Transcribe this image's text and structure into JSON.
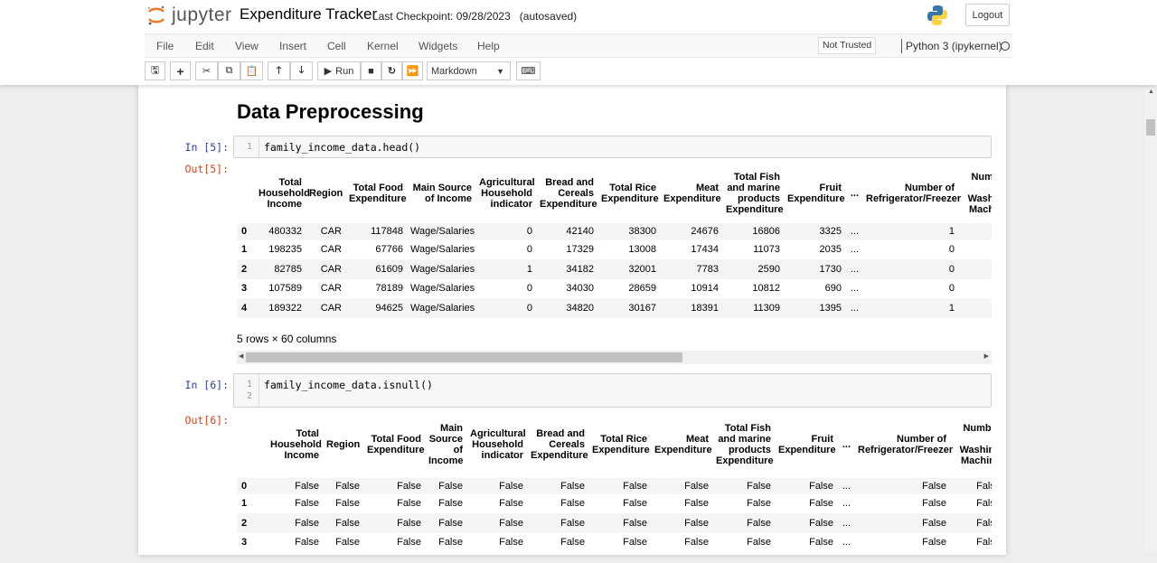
{
  "header": {
    "logo_text": "jupyter",
    "notebook_title": "Expenditure Tracker",
    "checkpoint": "Last Checkpoint: 09/28/2023",
    "autosave": "(autosaved)",
    "logout_label": "Logout"
  },
  "menubar": {
    "items": [
      "File",
      "Edit",
      "View",
      "Insert",
      "Cell",
      "Kernel",
      "Widgets",
      "Help"
    ],
    "trust_label": "Not Trusted",
    "kernel_name": "Python 3 (ipykernel)"
  },
  "toolbar": {
    "run_label": "Run",
    "cell_type": "Markdown"
  },
  "cells": [
    {
      "type": "markdown",
      "text": "Data Preprocessing"
    },
    {
      "in_prompt": "In [5]:",
      "out_prompt": "Out[5]:",
      "code": [
        "family_income_data.head()"
      ],
      "line_numbers": [
        "1"
      ],
      "columns": [
        "",
        "Total Household Income",
        "Region",
        "Total Food Expenditure",
        "Main Source of Income",
        "Agricultural Household indicator",
        "Bread and Cereals Expenditure",
        "Total Rice Expenditure",
        "Meat Expenditure",
        "Total Fish and marine products Expenditure",
        "Fruit Expenditure",
        "...",
        "Number of Refrigerator/Freezer",
        "Number of Washing Machine"
      ],
      "rows": [
        [
          "0",
          "480332",
          "CAR",
          "117848",
          "Wage/Salaries",
          "0",
          "42140",
          "38300",
          "24676",
          "16806",
          "3325",
          "...",
          "1",
          ""
        ],
        [
          "1",
          "198235",
          "CAR",
          "67766",
          "Wage/Salaries",
          "0",
          "17329",
          "13008",
          "17434",
          "11073",
          "2035",
          "...",
          "0",
          ""
        ],
        [
          "2",
          "82785",
          "CAR",
          "61609",
          "Wage/Salaries",
          "1",
          "34182",
          "32001",
          "7783",
          "2590",
          "1730",
          "...",
          "0",
          ""
        ],
        [
          "3",
          "107589",
          "CAR",
          "78189",
          "Wage/Salaries",
          "0",
          "34030",
          "28659",
          "10914",
          "10812",
          "690",
          "...",
          "0",
          ""
        ],
        [
          "4",
          "189322",
          "CAR",
          "94625",
          "Wage/Salaries",
          "0",
          "34820",
          "30167",
          "18391",
          "11309",
          "1395",
          "...",
          "1",
          ""
        ]
      ],
      "shape": "5 rows × 60 columns"
    },
    {
      "in_prompt": "In [6]:",
      "out_prompt": "Out[6]:",
      "code": [
        "family_income_data.isnull()",
        ""
      ],
      "line_numbers": [
        "1",
        "2"
      ],
      "columns": [
        "",
        "Total Household Income",
        "Region",
        "Total Food Expenditure",
        "Main Source of Income",
        "Agricultural Household indicator",
        "Bread and Cereals Expenditure",
        "Total Rice Expenditure",
        "Meat Expenditure",
        "Total Fish and marine products Expenditure",
        "Fruit Expenditure",
        "...",
        "Number of Refrigerator/Freezer",
        "Number of Washing Machine"
      ],
      "rows": [
        [
          "0",
          "False",
          "False",
          "False",
          "False",
          "False",
          "False",
          "False",
          "False",
          "False",
          "False",
          "...",
          "False",
          "False"
        ],
        [
          "1",
          "False",
          "False",
          "False",
          "False",
          "False",
          "False",
          "False",
          "False",
          "False",
          "False",
          "...",
          "False",
          "False"
        ],
        [
          "2",
          "False",
          "False",
          "False",
          "False",
          "False",
          "False",
          "False",
          "False",
          "False",
          "False",
          "...",
          "False",
          "False"
        ],
        [
          "3",
          "False",
          "False",
          "False",
          "False",
          "False",
          "False",
          "False",
          "False",
          "False",
          "False",
          "...",
          "False",
          "False"
        ]
      ]
    }
  ]
}
